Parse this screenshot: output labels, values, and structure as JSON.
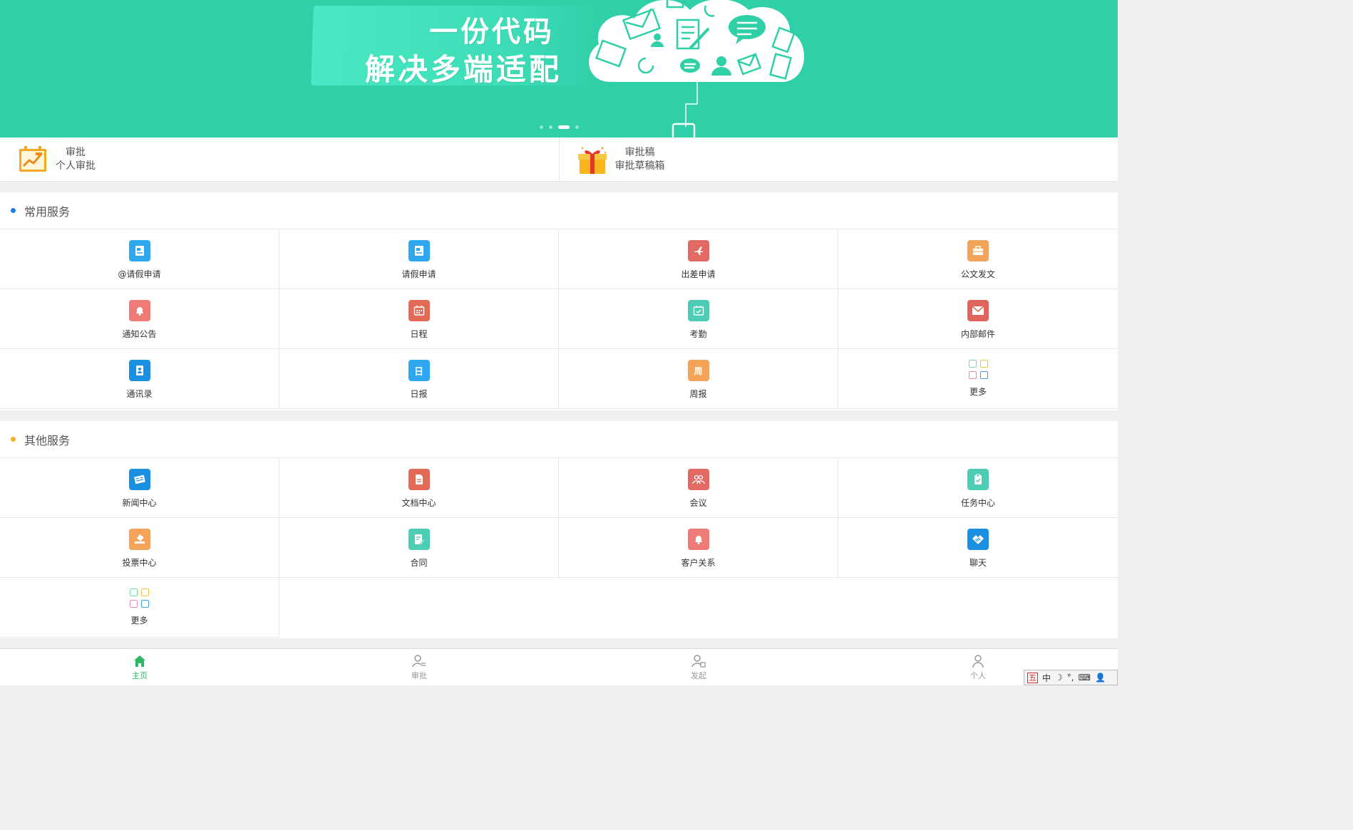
{
  "banner": {
    "line1": "一份代码",
    "line2": "解决多端适配",
    "pages": 4,
    "active_page": 3,
    "bg_color": "#2fcfa8"
  },
  "quick": [
    {
      "title": "审批",
      "subtitle": "个人审批",
      "icon": "chart-board-icon"
    },
    {
      "title": "审批稿",
      "subtitle": "审批草稿箱",
      "icon": "gift-box-icon"
    }
  ],
  "common": {
    "title": "常用服务",
    "bullet_color": "#1a7ef2",
    "items": [
      {
        "label": "@请假申请",
        "icon": "leave-request-icon",
        "color": "#2ea7f0"
      },
      {
        "label": "请假申请",
        "icon": "leave-request-icon",
        "color": "#2ea7f0"
      },
      {
        "label": "出差申请",
        "icon": "airplane-icon",
        "color": "#e26a63"
      },
      {
        "label": "公文发文",
        "icon": "briefcase-icon",
        "color": "#f4a35a"
      },
      {
        "label": "通知公告",
        "icon": "bell-icon",
        "color": "#ef7b77"
      },
      {
        "label": "日程",
        "icon": "calendar-icon",
        "color": "#e26a56"
      },
      {
        "label": "考勤",
        "icon": "checkin-icon",
        "color": "#4ccdb4"
      },
      {
        "label": "内部邮件",
        "icon": "mail-icon",
        "color": "#e0665d"
      },
      {
        "label": "通讯录",
        "icon": "contacts-icon",
        "color": "#1b8fe0"
      },
      {
        "label": "日报",
        "icon": "daily-report-icon",
        "glyph": "日",
        "color": "#2ea7f0"
      },
      {
        "label": "周报",
        "icon": "weekly-report-icon",
        "glyph": "周",
        "color": "#f4a35a"
      },
      {
        "label": "更多",
        "icon": "more-grid-icon",
        "color": ""
      }
    ]
  },
  "other": {
    "title": "其他服务",
    "bullet_color": "#f5b21c",
    "items": [
      {
        "label": "新闻中心",
        "icon": "newspaper-icon",
        "color": "#1b8fe0"
      },
      {
        "label": "文档中心",
        "icon": "document-icon",
        "color": "#e26a56"
      },
      {
        "label": "会议",
        "icon": "meeting-icon",
        "color": "#e26a63"
      },
      {
        "label": "任务中心",
        "icon": "clipboard-icon",
        "color": "#4ccdb4"
      },
      {
        "label": "投票中心",
        "icon": "vote-icon",
        "color": "#f4a35a"
      },
      {
        "label": "合同",
        "icon": "contract-icon",
        "color": "#4ccdb4"
      },
      {
        "label": "客户关系",
        "icon": "bell-icon",
        "color": "#ef7b77"
      },
      {
        "label": "聊天",
        "icon": "handshake-icon",
        "color": "#1b8fe0"
      },
      {
        "label": "更多",
        "icon": "more-grid-icon",
        "color": ""
      }
    ]
  },
  "tabs": [
    {
      "label": "主页",
      "icon": "home-icon",
      "active": true
    },
    {
      "label": "审批",
      "icon": "approval-icon",
      "active": false
    },
    {
      "label": "发起",
      "icon": "initiate-icon",
      "active": false
    },
    {
      "label": "个人",
      "icon": "person-icon",
      "active": false
    }
  ],
  "accent_color": "#2fb864",
  "ime": {
    "items": [
      "五",
      "中",
      "☽",
      "°,",
      "⌨",
      "👤",
      "⚙"
    ]
  }
}
